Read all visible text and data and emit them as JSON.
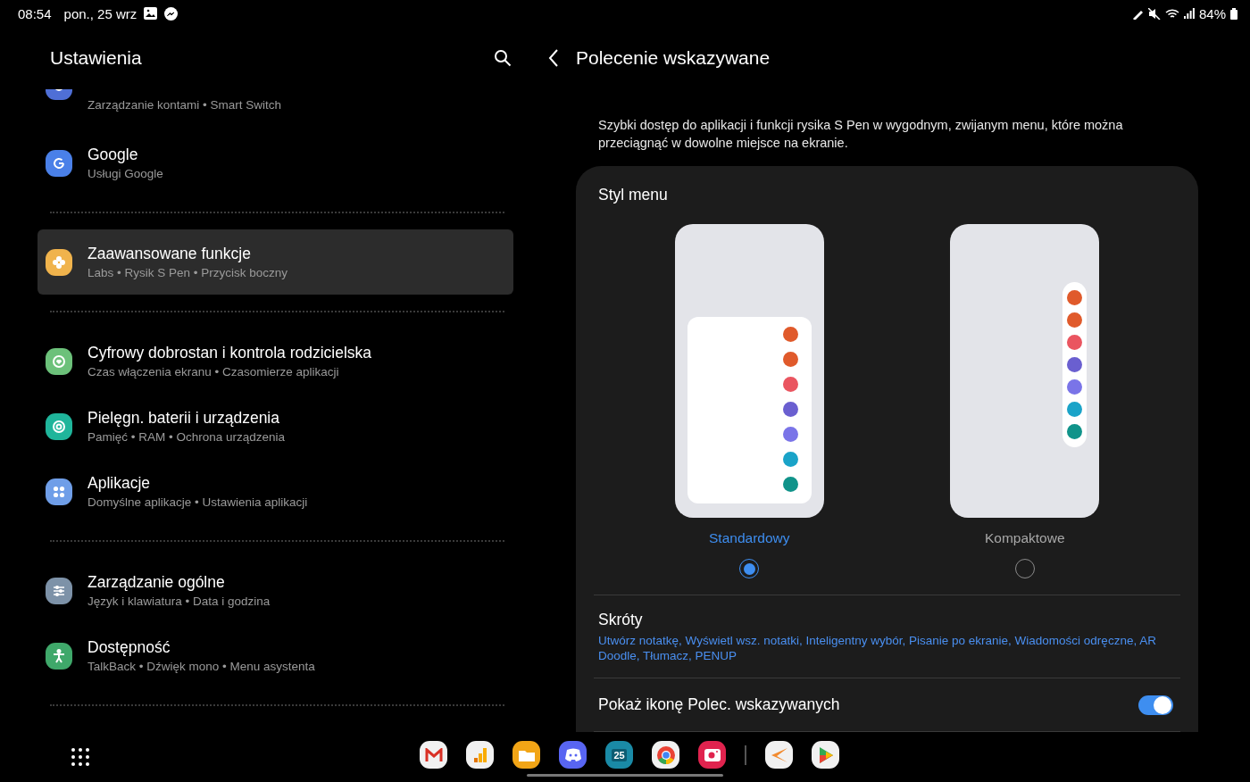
{
  "status_bar": {
    "time": "08:54",
    "date": "pon., 25 wrz",
    "battery": "84%"
  },
  "settings": {
    "title": "Ustawienia",
    "groups": [
      {
        "items": [
          {
            "subtitle": "Zarządzanie kontami • Smart Switch",
            "partial": true,
            "selected": false,
            "color": "#4f6fd6"
          },
          {
            "title": "Google",
            "subtitle": "Usługi Google",
            "selected": false,
            "color": "#4a80e8"
          }
        ]
      },
      {
        "items": [
          {
            "title": "Zaawansowane funkcje",
            "subtitle": "Labs • Rysik S Pen • Przycisk boczny",
            "selected": true,
            "color": "#f0b34c"
          }
        ]
      },
      {
        "items": [
          {
            "title": "Cyfrowy dobrostan i kontrola rodzicielska",
            "subtitle": "Czas włączenia ekranu • Czasomierze aplikacji",
            "selected": false,
            "color": "#6cc17a"
          },
          {
            "title": "Pielęgn. baterii i urządzenia",
            "subtitle": "Pamięć • RAM • Ochrona urządzenia",
            "selected": false,
            "color": "#1fb59b"
          },
          {
            "title": "Aplikacje",
            "subtitle": "Domyślne aplikacje • Ustawienia aplikacji",
            "selected": false,
            "color": "#6f9ee8"
          }
        ]
      },
      {
        "items": [
          {
            "title": "Zarządzanie ogólne",
            "subtitle": "Język i klawiatura • Data i godzina",
            "selected": false,
            "color": "#7d92a8"
          },
          {
            "title": "Dostępność",
            "subtitle": "TalkBack • Dźwięk mono • Menu asystenta",
            "selected": false,
            "color": "#3fa86a"
          }
        ]
      }
    ]
  },
  "detail": {
    "title": "Polecenie wskazywane",
    "description": "Szybki dostęp do aplikacji i funkcji rysika S Pen w wygodnym, zwijanym menu, które można przeciągnąć w dowolne miejsce na ekranie.",
    "menu_style": {
      "title": "Styl menu",
      "options": [
        {
          "label": "Standardowy",
          "kind": "standard",
          "selected": true
        },
        {
          "label": "Kompaktowe",
          "kind": "compact",
          "selected": false
        }
      ]
    },
    "shortcuts": {
      "title": "Skróty",
      "value": "Utwórz notatkę, Wyświetl wsz. notatki, Inteligentny wybór, Pisanie po ekranie, Wiadomości odręczne, AR Doodle, Tłumacz, PENUP"
    },
    "show_icon": {
      "label": "Pokaż ikonę Polec. wskazywanych",
      "on": true
    }
  },
  "dock": {
    "calendar_day": "25"
  }
}
